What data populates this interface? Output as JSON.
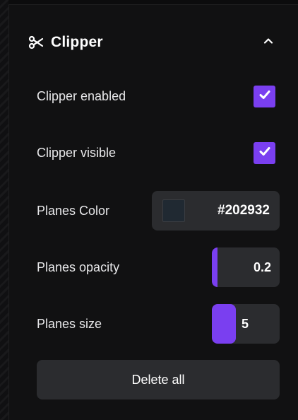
{
  "panel": {
    "title": "Clipper",
    "icon": "scissors-icon",
    "collapse_icon": "chevron-up-icon"
  },
  "settings": {
    "clipper_enabled": {
      "label": "Clipper enabled",
      "checked": true
    },
    "clipper_visible": {
      "label": "Clipper visible",
      "checked": true
    },
    "planes_color": {
      "label": "Planes Color",
      "value": "#202932"
    },
    "planes_opacity": {
      "label": "Planes opacity",
      "value": "0.2"
    },
    "planes_size": {
      "label": "Planes size",
      "value": "5"
    }
  },
  "actions": {
    "delete_all_label": "Delete all"
  },
  "colors": {
    "accent": "#7a3ff0",
    "field_bg": "#2b2c2f",
    "panel_bg": "#111112",
    "swatch": "#202932"
  }
}
